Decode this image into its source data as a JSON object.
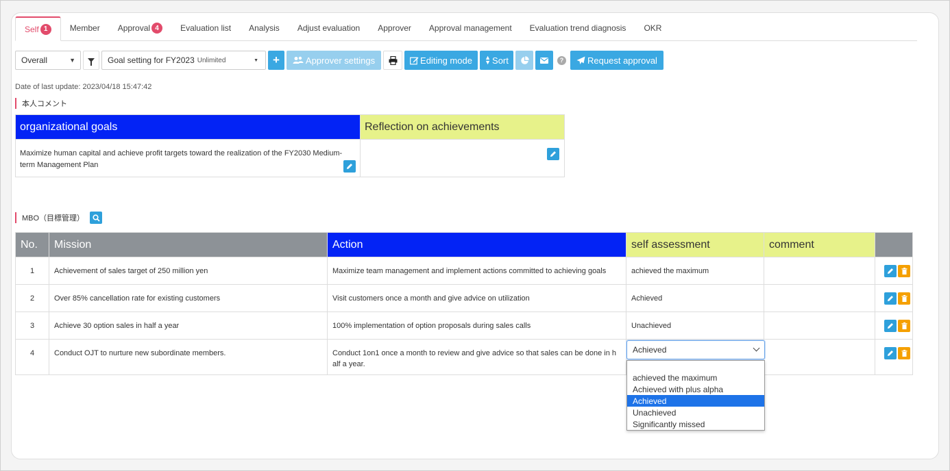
{
  "tabs": [
    {
      "label": "Self",
      "badge": "1"
    },
    {
      "label": "Member",
      "badge": ""
    },
    {
      "label": "Approval",
      "badge": "4"
    },
    {
      "label": "Evaluation list",
      "badge": ""
    },
    {
      "label": "Analysis",
      "badge": ""
    },
    {
      "label": "Adjust evaluation",
      "badge": ""
    },
    {
      "label": "Approver",
      "badge": ""
    },
    {
      "label": "Approval management",
      "badge": ""
    },
    {
      "label": "Evaluation trend diagnosis",
      "badge": ""
    },
    {
      "label": "OKR",
      "badge": ""
    }
  ],
  "toolbar": {
    "scope_select": "Overall",
    "goal_select": "Goal setting for FY2023",
    "goal_select_tag": "Unlimited",
    "add_label": "+",
    "approver_settings": "Approver settings",
    "editing_mode": "Editing mode",
    "sort": "Sort",
    "request_approval": "Request approval",
    "help": "?"
  },
  "last_update": "Date of last update: 2023/04/18 15:47:42",
  "comment_section_label": "本人コメント",
  "org_table": {
    "col1_header": "organizational goals",
    "col2_header": "Reflection on achievements",
    "col1_text": "Maximize human capital and achieve profit targets toward the realization of the FY2030 Medium-term Management Plan",
    "col2_text": ""
  },
  "mbo_section_label": "MBO（目標管理）",
  "mbo_table": {
    "headers": {
      "no": "No.",
      "mission": "Mission",
      "action": "Action",
      "self": "self assessment",
      "comment": "comment"
    },
    "rows": [
      {
        "no": "1",
        "mission": "Achievement of sales target of 250 million yen",
        "action": "Maximize team management and implement actions committed to achieving goals",
        "self": "achieved the maximum",
        "comment": ""
      },
      {
        "no": "2",
        "mission": "Over 85% cancellation rate for existing customers",
        "action": "Visit customers once a month and give advice on utilization",
        "self": "Achieved",
        "comment": ""
      },
      {
        "no": "3",
        "mission": "Achieve 30 option sales in half a year",
        "action": "100% implementation of option proposals during sales calls",
        "self": "Unachieved",
        "comment": ""
      },
      {
        "no": "4",
        "mission": "Conduct OJT to nurture new subordinate members.",
        "action": "Conduct 1on1 once a month to review and give advice so that sales can be done in h alf a year.",
        "self": "",
        "comment": ""
      }
    ]
  },
  "dropdown": {
    "value": "Achieved",
    "options": [
      "achieved the maximum",
      "Achieved with plus alpha",
      "Achieved",
      "Unachieved",
      "Significantly missed"
    ],
    "selected_index": 2
  },
  "colors": {
    "accent_pink": "#e24b6b",
    "blue_header": "#0323f5",
    "yellow_header": "#e7f28a",
    "button_blue": "#3aa8e2",
    "delete_orange": "#f5a000"
  }
}
